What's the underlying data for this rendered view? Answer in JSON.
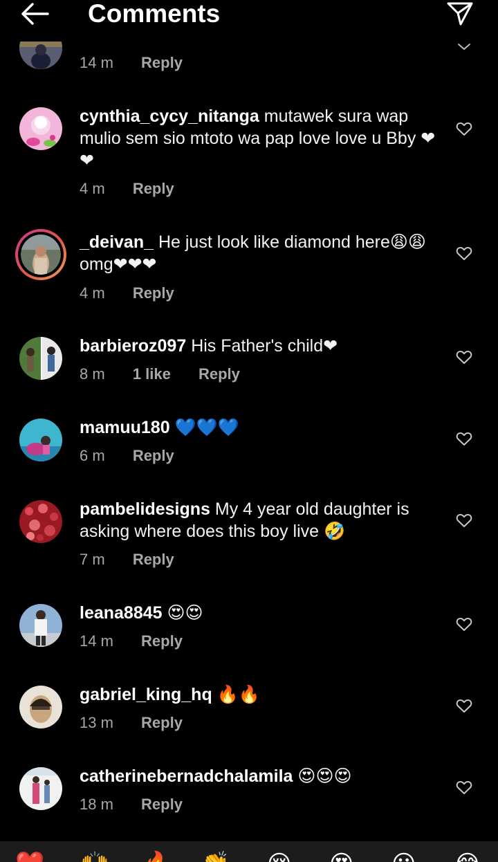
{
  "header": {
    "title": "Comments",
    "back_icon": "arrow-left-icon",
    "send_icon": "paper-plane-icon"
  },
  "colors": {
    "background": "#000000",
    "text": "#ffffff",
    "muted": "#a8a8a8",
    "story_ring_start": "#c7368f",
    "story_ring_end": "#f0a35a",
    "bottom_bar": "#1c1c1c"
  },
  "comments": [
    {
      "username": "",
      "text": "",
      "time": "14 m",
      "likes": "",
      "reply_label": "Reply"
    },
    {
      "username": "cynthia_cycy_nitanga",
      "text": " mutawek  sura wap mulio sem sio mtoto wa pap love love u Bby ❤❤",
      "time": "4 m",
      "likes": "",
      "reply_label": "Reply"
    },
    {
      "username": "_deivan_",
      "text": " He just look like diamond here😩😩omg❤❤❤",
      "time": "4 m",
      "likes": "",
      "reply_label": "Reply"
    },
    {
      "username": "barbieroz097",
      "text": " His Father's child❤",
      "time": "8 m",
      "likes": "1 like",
      "reply_label": "Reply"
    },
    {
      "username": "mamuu180",
      "text": " 💙💙💙",
      "time": "6 m",
      "likes": "",
      "reply_label": "Reply"
    },
    {
      "username": "pambelidesigns",
      "text": " My 4 year old daughter is asking where does this boy live 🤣",
      "time": "7 m",
      "likes": "",
      "reply_label": "Reply"
    },
    {
      "username": "leana8845",
      "text": " 😍😍",
      "time": "14 m",
      "likes": "",
      "reply_label": "Reply"
    },
    {
      "username": "gabriel_king_hq",
      "text": " 🔥🔥",
      "time": "13 m",
      "likes": "",
      "reply_label": "Reply"
    },
    {
      "username": "catherinebernadchalamila",
      "text": " 😍😍😍",
      "time": "18 m",
      "likes": "",
      "reply_label": "Reply"
    }
  ],
  "quick_reactions": [
    "❤️",
    "🙌",
    "🔥",
    "👏",
    "😢",
    "😍",
    "😮",
    "😂"
  ]
}
